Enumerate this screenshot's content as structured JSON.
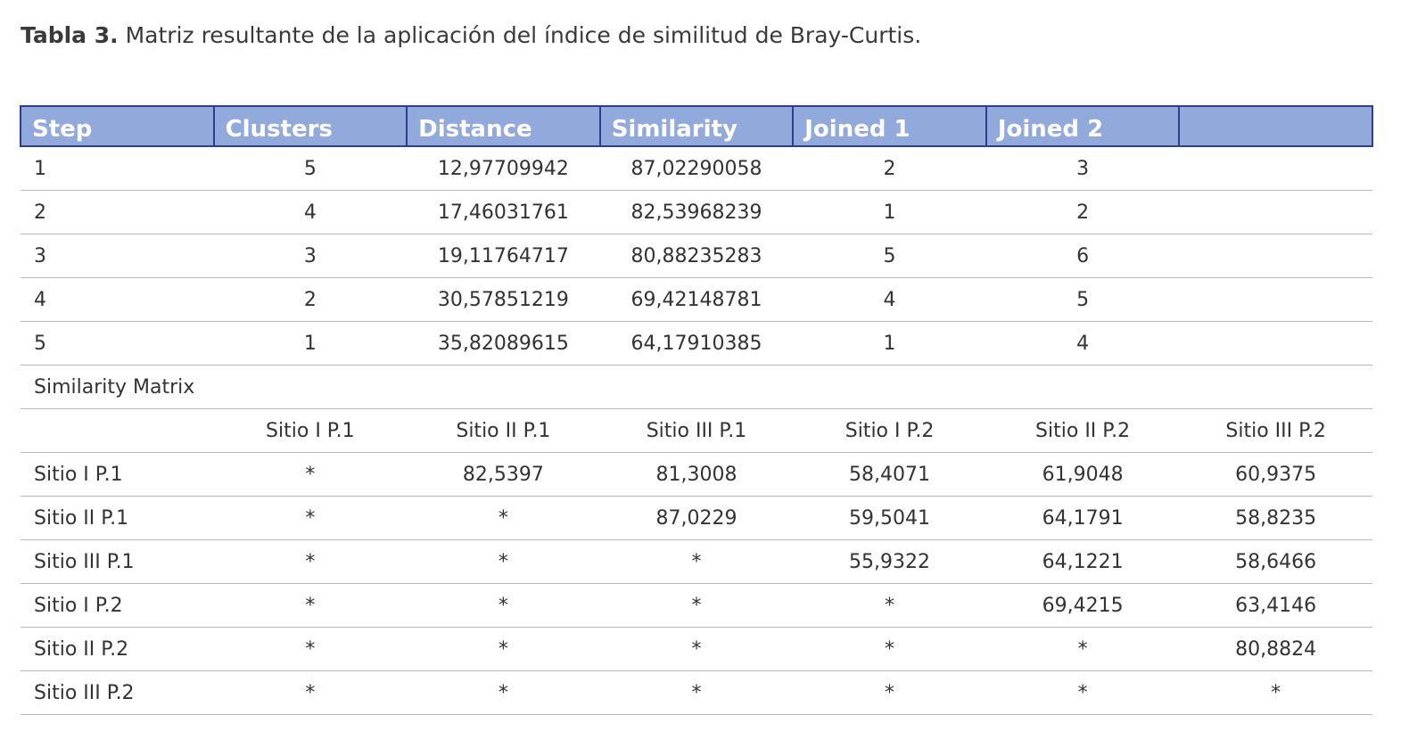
{
  "caption": {
    "label": "Tabla 3.",
    "text": " Matriz resultante de la aplicación del índice de similitud de Bray-Curtis."
  },
  "colors": {
    "header_bg": "#92aadb",
    "header_border": "#2a3f8f",
    "row_line": "#b8b8b8"
  },
  "table": {
    "headers": [
      "Step",
      "Clusters",
      "Distance",
      "Similarity",
      "Joined 1",
      "Joined 2",
      ""
    ],
    "steps": [
      [
        "1",
        "5",
        "12,97709942",
        "87,02290058",
        "2",
        "3",
        ""
      ],
      [
        "2",
        "4",
        "17,46031761",
        "82,53968239",
        "1",
        "2",
        ""
      ],
      [
        "3",
        "3",
        "19,11764717",
        "80,88235283",
        "5",
        "6",
        ""
      ],
      [
        "4",
        "2",
        "30,57851219",
        "69,42148781",
        "4",
        "5",
        ""
      ],
      [
        "5",
        "1",
        "35,82089615",
        "64,17910385",
        "1",
        "4",
        ""
      ]
    ],
    "section_label": "Similarity Matrix",
    "matrix_header": [
      "",
      "Sitio I P.1",
      "Sitio II P.1",
      "Sitio III P.1",
      "Sitio I P.2",
      "Sitio II P.2",
      "Sitio III P.2"
    ],
    "matrix": [
      [
        "Sitio I P.1",
        "*",
        "82,5397",
        "81,3008",
        "58,4071",
        "61,9048",
        "60,9375"
      ],
      [
        "Sitio II P.1",
        "*",
        "*",
        "87,0229",
        "59,5041",
        "64,1791",
        "58,8235"
      ],
      [
        "Sitio III P.1",
        "*",
        "*",
        "*",
        "55,9322",
        "64,1221",
        "58,6466"
      ],
      [
        "Sitio I P.2",
        "*",
        "*",
        "*",
        "*",
        "69,4215",
        "63,4146"
      ],
      [
        "Sitio II P.2",
        "*",
        "*",
        "*",
        "*",
        "*",
        "80,8824"
      ],
      [
        "Sitio III P.2",
        "*",
        "*",
        "*",
        "*",
        "*",
        "*"
      ]
    ]
  }
}
